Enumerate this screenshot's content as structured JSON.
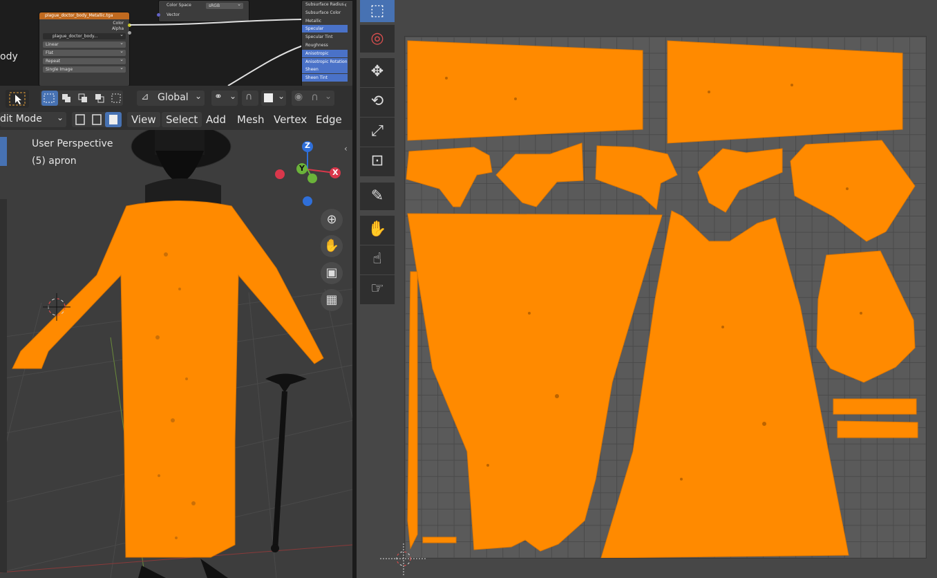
{
  "node_editor": {
    "image_node_title": "plague_doctor_body_Metallic.tga",
    "outputs": [
      "Color",
      "Alpha"
    ],
    "image_name": "plague_doctor_body...",
    "interpolation": "Linear",
    "projection": "Flat",
    "extension": "Repeat",
    "source": "Single Image",
    "colorspace_label": "Color Space",
    "colorspace_value": "sRGB",
    "vector_label": "Vector",
    "left_clipped_text": "ody",
    "bsdf_inputs": [
      {
        "label": "Subsurface Radius",
        "highlight": false
      },
      {
        "label": "Subsurface Color",
        "highlight": false
      },
      {
        "label": "Metallic",
        "highlight": false
      },
      {
        "label": "Specular",
        "highlight": true
      },
      {
        "label": "Specular Tint",
        "highlight": false
      },
      {
        "label": "Roughness",
        "highlight": false
      },
      {
        "label": "Anisotropic",
        "highlight": true
      },
      {
        "label": "Anisotropic Rotation",
        "highlight": true
      },
      {
        "label": "Sheen",
        "highlight": true
      },
      {
        "label": "Sheen Tint",
        "highlight": true
      }
    ]
  },
  "header": {
    "transform_orientation": "Global",
    "mode": "dit Mode",
    "menus": [
      "View",
      "Select",
      "Add",
      "Mesh",
      "Vertex",
      "Edge"
    ]
  },
  "viewport": {
    "perspective_label": "User Perspective",
    "object_label": "(5) apron",
    "gizmo": {
      "z": "Z",
      "y": "Y",
      "x": "X"
    }
  },
  "colors": {
    "selection_orange": "#ff8a00",
    "active_blue": "#4772b3",
    "header_orange": "#c06a1f"
  }
}
